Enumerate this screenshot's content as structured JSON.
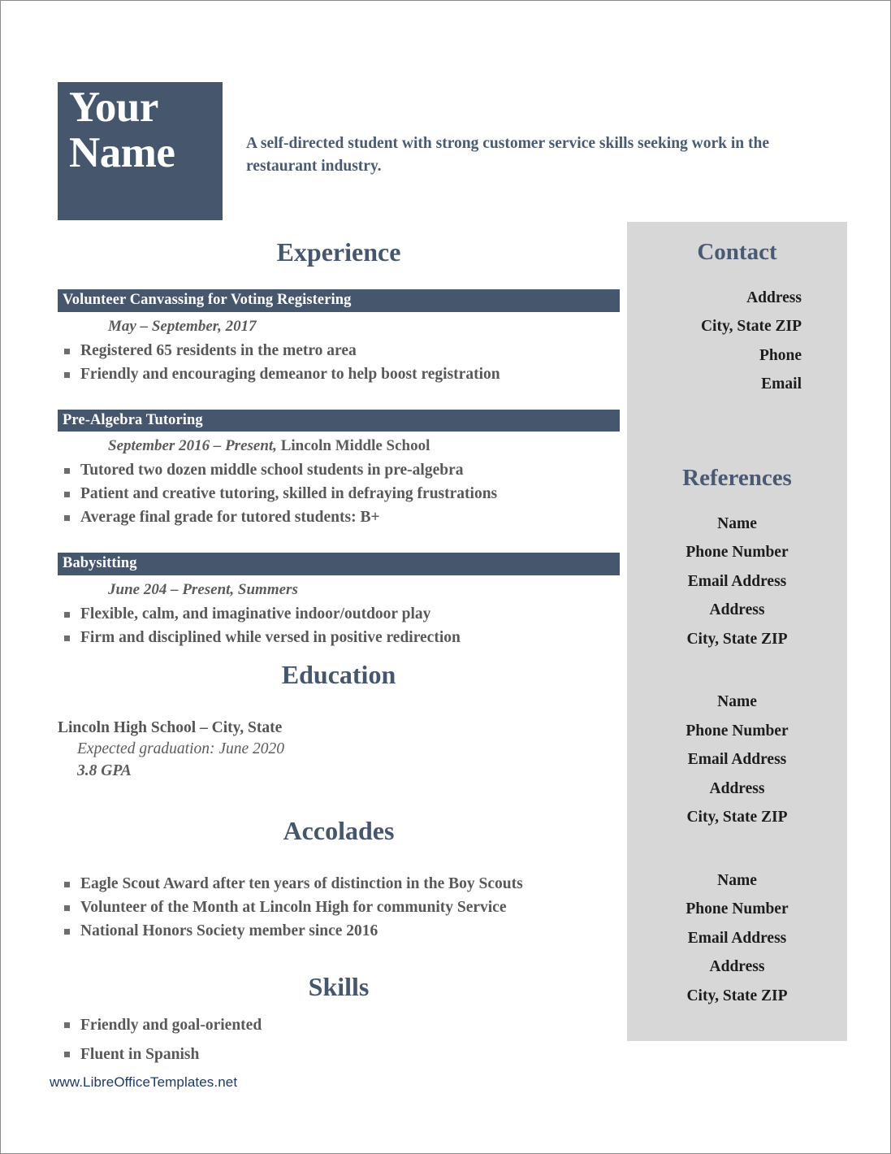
{
  "colors": {
    "navy": "#46566d",
    "heading_blue": "#4a5a73",
    "sidebar_gray": "#d7d7d7",
    "body_gray": "#585858",
    "footer_navy": "#1f3864",
    "page_white": "#ffffff"
  },
  "header": {
    "name_line1": "Your",
    "name_line2": "Name",
    "tagline": "A self-directed student with strong customer service skills seeking work in the restaurant industry."
  },
  "sections": {
    "experience_title": "Experience",
    "education_title": "Education",
    "accolades_title": "Accolades",
    "skills_title": "Skills"
  },
  "experience": {
    "jobs": [
      {
        "title": "Volunteer Canvassing for Voting Registering",
        "date": "May – September, 2017",
        "organization": "",
        "bullets": [
          "Registered 65 residents in the metro area",
          "Friendly and encouraging demeanor to help boost registration"
        ]
      },
      {
        "title": "Pre-Algebra Tutoring",
        "date": "September 2016 – Present,",
        "organization": " Lincoln Middle School",
        "bullets": [
          "Tutored two dozen middle school students in pre-algebra",
          "Patient and creative tutoring, skilled in defraying frustrations",
          "Average final grade for tutored students: B+"
        ]
      },
      {
        "title": "Babysitting",
        "date": "June 204 – Present, Summers",
        "organization": "",
        "bullets": [
          "Flexible, calm, and imaginative indoor/outdoor play",
          "Firm and disciplined while versed in positive redirection"
        ]
      }
    ]
  },
  "education": {
    "school": "Lincoln High School – City, State",
    "graduation": "Expected graduation: June 2020",
    "gpa": "3.8 GPA"
  },
  "accolades": {
    "items": [
      "Eagle Scout Award after ten years of distinction in the Boy Scouts",
      "Volunteer of the Month at Lincoln High for community Service",
      "National Honors Society member since 2016"
    ]
  },
  "skills": {
    "items": [
      "Friendly and goal-oriented",
      "Fluent in Spanish"
    ]
  },
  "contact": {
    "title": "Contact",
    "items": [
      "Address",
      "City, State ZIP",
      "Phone",
      "Email"
    ]
  },
  "references": {
    "title": "References",
    "groups": [
      {
        "name": "Name",
        "phone": "Phone Number",
        "email": "Email Address",
        "address": "Address",
        "city": "City, State ZIP"
      },
      {
        "name": "Name",
        "phone": "Phone Number",
        "email": "Email Address",
        "address": "Address",
        "city": "City, State ZIP"
      },
      {
        "name": "Name",
        "phone": "Phone Number",
        "email": "Email Address",
        "address": "Address",
        "city": "City, State ZIP"
      }
    ]
  },
  "footer": {
    "url": "www.LibreOfficeTemplates.net"
  }
}
